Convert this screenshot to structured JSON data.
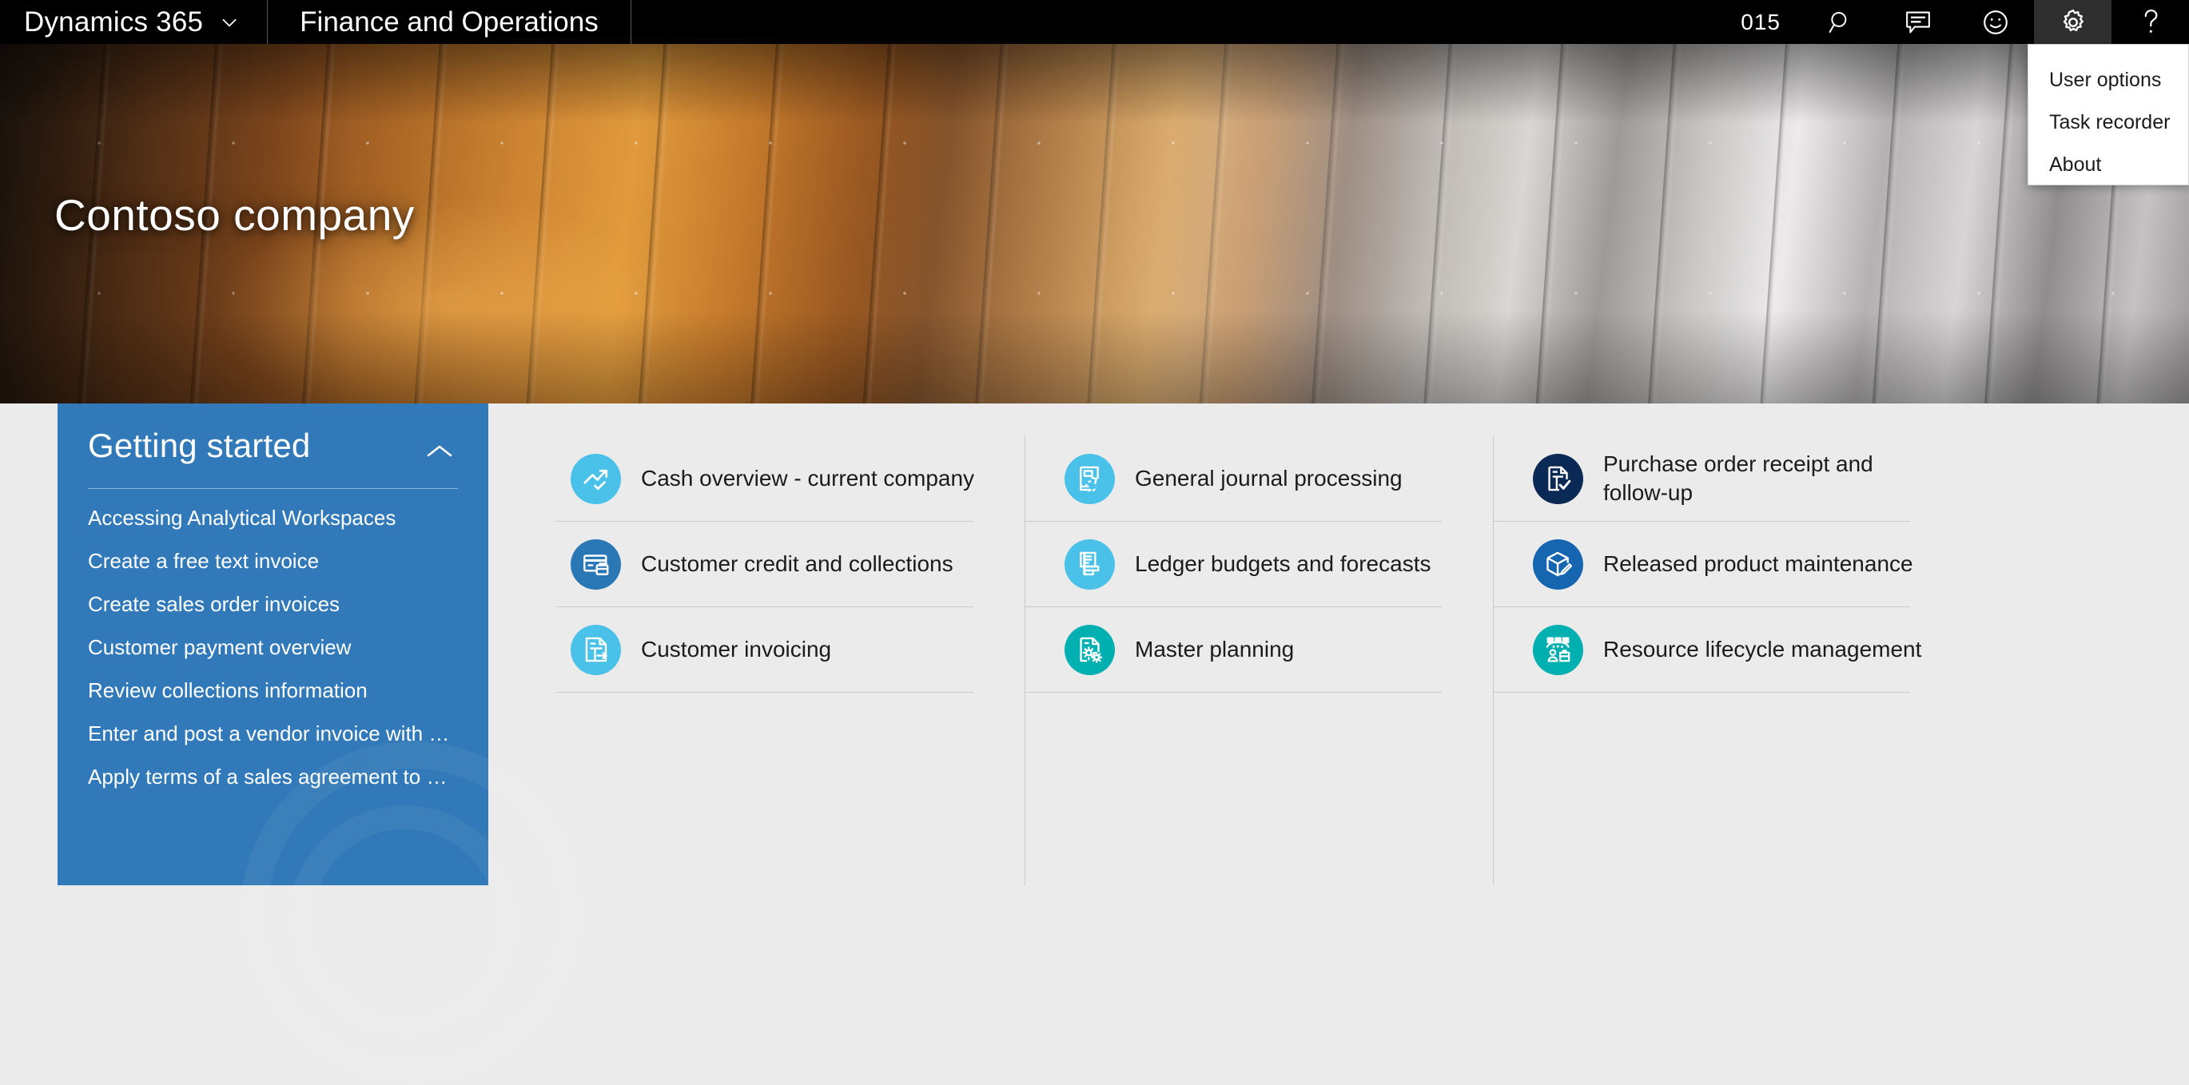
{
  "topbar": {
    "brand": "Dynamics 365",
    "brand_caret_icon": "chevron-down-icon",
    "app_name": "Finance and Operations",
    "company_id": "015",
    "icons": {
      "search": "search-icon",
      "messages": "message-icon",
      "feedback": "smiley-face-icon",
      "settings": "gear-icon",
      "help": "question-mark-icon"
    }
  },
  "settings_menu": {
    "items": [
      {
        "label": "User options"
      },
      {
        "label": "Task recorder"
      },
      {
        "label": "About"
      }
    ]
  },
  "hero": {
    "title": "Contoso company"
  },
  "getting_started": {
    "title": "Getting started",
    "collapse_icon": "chevron-up-icon",
    "links": [
      {
        "label": "Accessing Analytical Workspaces"
      },
      {
        "label": "Create a free text invoice"
      },
      {
        "label": "Create sales order invoices"
      },
      {
        "label": "Customer payment overview"
      },
      {
        "label": "Review collections information"
      },
      {
        "label": "Enter and post a vendor invoice with m..."
      },
      {
        "label": "Apply terms of a sales agreement to a s..."
      }
    ]
  },
  "workspace_tiles": {
    "columns": [
      {
        "tiles": [
          {
            "label": "Cash overview - current company",
            "icon": "trending-chart-icon",
            "color": "#4ac1e8"
          },
          {
            "label": "Customer credit and collections",
            "icon": "credit-card-icon",
            "color": "#2a77b5"
          },
          {
            "label": "Customer invoicing",
            "icon": "invoice-document-icon",
            "color": "#4ac1e8"
          }
        ]
      },
      {
        "tiles": [
          {
            "label": "General journal processing",
            "icon": "journal-book-icon",
            "color": "#4ac1e8"
          },
          {
            "label": "Ledger budgets and forecasts",
            "icon": "budget-bars-icon",
            "color": "#4ac1e8"
          },
          {
            "label": "Master planning",
            "icon": "document-gears-icon",
            "color": "#00afb0"
          }
        ]
      },
      {
        "tiles": [
          {
            "label": "Purchase order receipt and follow-up",
            "icon": "document-check-icon",
            "color": "#0a2a55"
          },
          {
            "label": "Released product maintenance",
            "icon": "box-pencil-icon",
            "color": "#1565b0"
          },
          {
            "label": "Resource lifecycle management",
            "icon": "resource-people-icon",
            "color": "#00afb0"
          }
        ]
      }
    ]
  },
  "colors": {
    "topbar_bg": "#000000",
    "active_btn_bg": "#2f2f2f",
    "panel_blue": "#3179b8",
    "page_bg": "#ebebeb",
    "separator": "#c9c9c9"
  }
}
